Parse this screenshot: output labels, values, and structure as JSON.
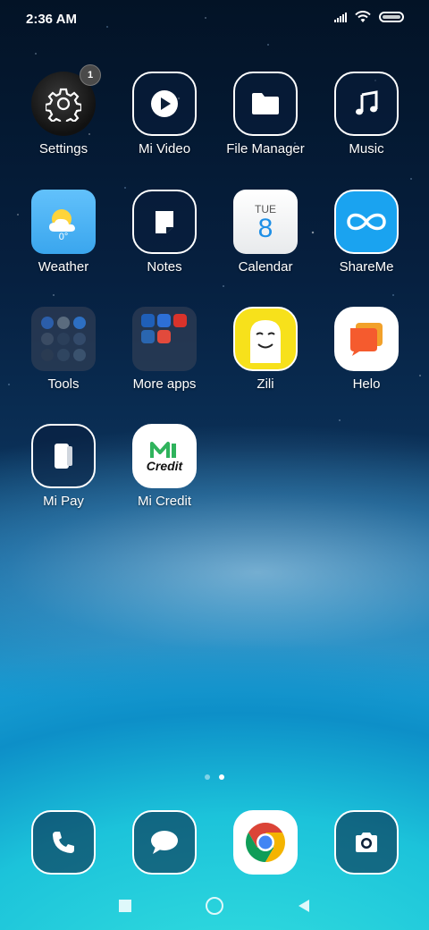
{
  "status_bar": {
    "time": "2:36 AM",
    "icons": [
      "signal-icon",
      "wifi-icon",
      "battery-icon"
    ]
  },
  "apps": {
    "settings": {
      "label": "Settings",
      "badge": "1"
    },
    "mi_video": {
      "label": "Mi Video"
    },
    "file_manager": {
      "label": "File Manager"
    },
    "music": {
      "label": "Music"
    },
    "weather": {
      "label": "Weather",
      "temp": "0°"
    },
    "notes": {
      "label": "Notes"
    },
    "calendar": {
      "label": "Calendar",
      "day": "TUE",
      "date": "8"
    },
    "shareme": {
      "label": "ShareMe"
    },
    "tools": {
      "label": "Tools"
    },
    "more_apps": {
      "label": "More apps"
    },
    "zili": {
      "label": "Zili"
    },
    "helo": {
      "label": "Helo"
    },
    "mi_pay": {
      "label": "Mi Pay"
    },
    "mi_credit": {
      "label": "Mi Credit",
      "logo_text": "Credit"
    }
  },
  "page_indicator": {
    "count": 2,
    "active_index": 1
  },
  "dock": {
    "phone": "phone-icon",
    "messages": "messages-icon",
    "chrome": "chrome-icon",
    "camera": "camera-icon"
  },
  "nav": [
    "recents-button",
    "home-button",
    "back-button"
  ],
  "colors": {
    "weather_bg": "#4cb4f4",
    "shareme_bg": "#1aa3f0",
    "zili_bg": "#f7e11b",
    "helo_orange": "#f7672c",
    "mi_credit_green": "#2fb35c"
  }
}
